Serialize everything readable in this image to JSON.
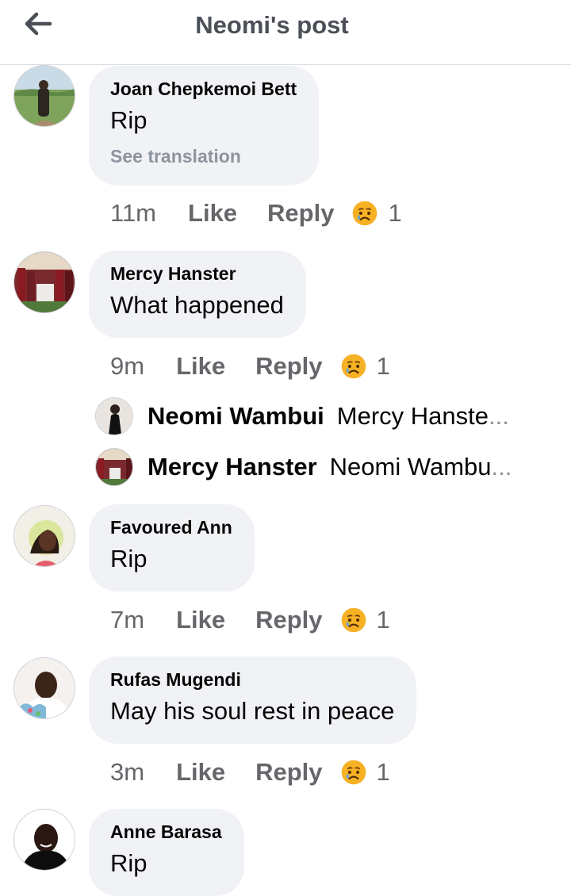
{
  "header": {
    "title": "Neomi's post",
    "back_icon": "arrow-left-icon"
  },
  "comments": [
    {
      "author": "Joan Chepkemoi Bett",
      "text": "Rip",
      "translation_link": "See translation",
      "time": "11m",
      "like": "Like",
      "reply": "Reply",
      "reaction_icon": "sad-emoji-icon",
      "reaction_count": "1"
    },
    {
      "author": "Mercy Hanster",
      "text": "What happened",
      "time": "9m",
      "like": "Like",
      "reply": "Reply",
      "reaction_icon": "sad-emoji-icon",
      "reaction_count": "1",
      "replies": [
        {
          "author": "Neomi Wambui",
          "snippet": "Mercy Hanste",
          "ellipsis": "..."
        },
        {
          "author": "Mercy Hanster",
          "snippet": "Neomi Wambu",
          "ellipsis": "..."
        }
      ]
    },
    {
      "author": "Favoured Ann",
      "text": "Rip",
      "time": "7m",
      "like": "Like",
      "reply": "Reply",
      "reaction_icon": "sad-emoji-icon",
      "reaction_count": "1"
    },
    {
      "author": "Rufas Mugendi",
      "text": "May his soul rest in peace",
      "time": "3m",
      "like": "Like",
      "reply": "Reply",
      "reaction_icon": "sad-emoji-icon",
      "reaction_count": "1"
    },
    {
      "author": "Anne Barasa",
      "text": "Rip"
    }
  ],
  "colors": {
    "bubble": "#f0f2f5",
    "muted": "#65676b",
    "reaction": "#f7b125"
  }
}
